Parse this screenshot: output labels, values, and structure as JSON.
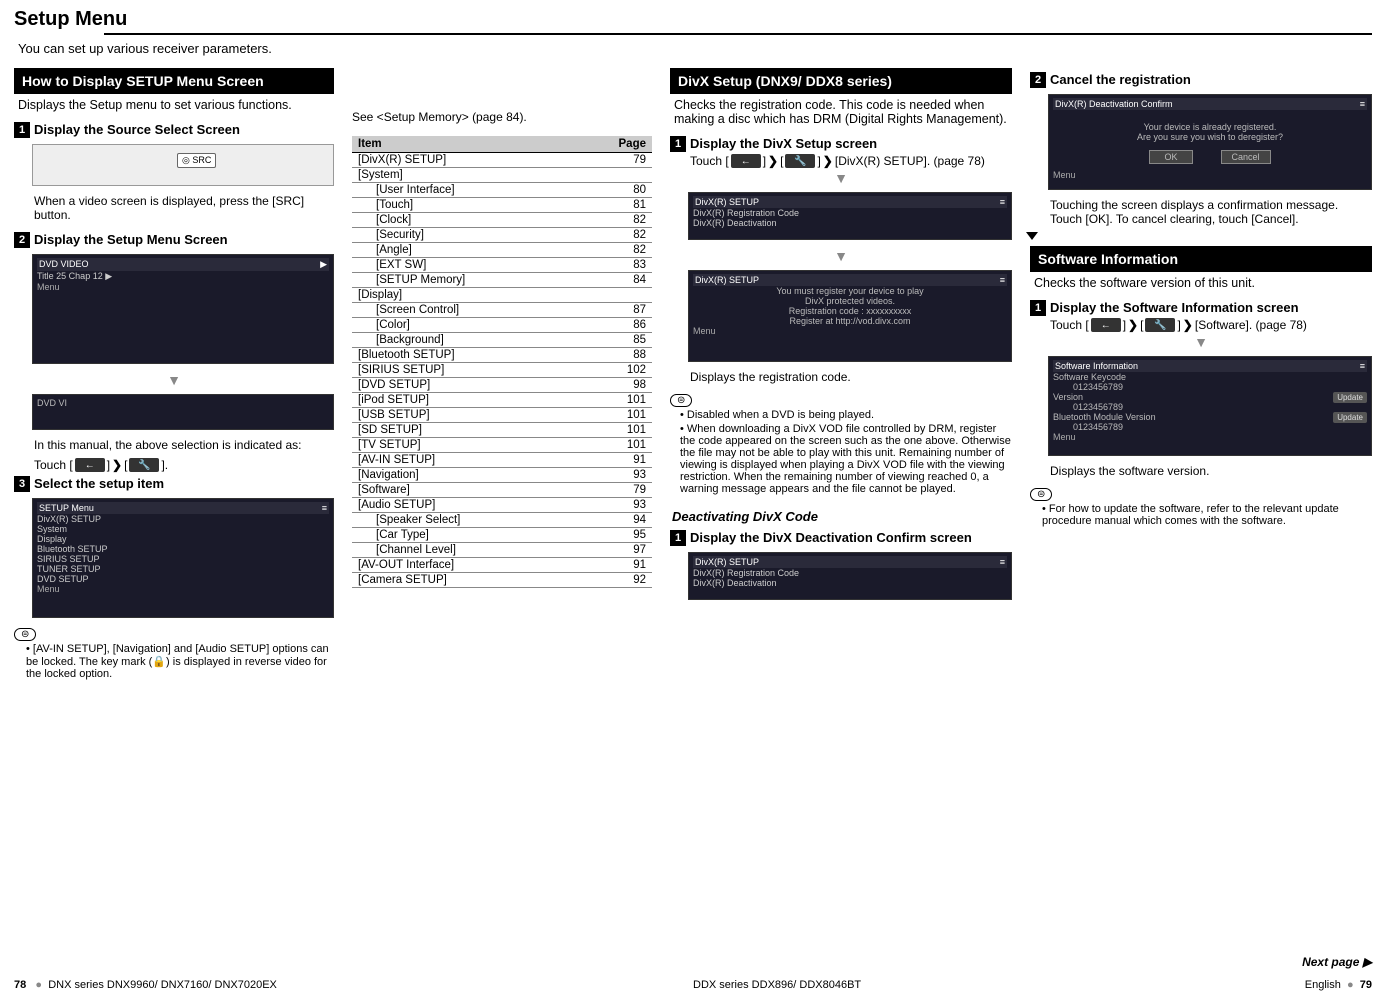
{
  "page_title": "Setup Menu",
  "intro": "You can set up various receiver parameters.",
  "col1": {
    "header": "How to Display SETUP Menu Screen",
    "sub": "Displays the Setup menu to set various functions.",
    "step1": "Display the Source Select Screen",
    "src_btn": "◎ SRC",
    "step1_body": "When a video screen is displayed, press the [SRC] button.",
    "step2": "Display the Setup Menu Screen",
    "dvd_title": "DVD VIDEO",
    "dvd_sub": "Title 25   Chap 12  ▶",
    "step2_body1": "In this manual, the above selection is indicated as:",
    "step2_body2a": "Touch [",
    "step2_body2b": "] ",
    "step2_body2c": " [",
    "step2_body2d": "].",
    "step3": "Select the setup item",
    "setup_menu_title": "SETUP Menu",
    "setup_menu_items": [
      "DivX(R) SETUP",
      "System",
      "Display",
      "Bluetooth SETUP",
      "SIRIUS SETUP",
      "TUNER SETUP",
      "DVD SETUP"
    ],
    "note1": "• [AV-IN SETUP], [Navigation] and [Audio SETUP] options can be locked. The key mark (🔒) is displayed in reverse video for the locked option."
  },
  "col2": {
    "see": "See <Setup Memory> (page 84).",
    "th_item": "Item",
    "th_page": "Page",
    "rows": [
      {
        "label": "[DivX(R) SETUP]",
        "page": "79",
        "indent": 0
      },
      {
        "label": "[System]",
        "page": "",
        "indent": 0
      },
      {
        "label": "[User Interface]",
        "page": "80",
        "indent": 1
      },
      {
        "label": "[Touch]",
        "page": "81",
        "indent": 1
      },
      {
        "label": "[Clock]",
        "page": "82",
        "indent": 1
      },
      {
        "label": "[Security]",
        "page": "82",
        "indent": 1
      },
      {
        "label": "[Angle]",
        "page": "82",
        "indent": 1
      },
      {
        "label": "[EXT SW]",
        "page": "83",
        "indent": 1
      },
      {
        "label": "[SETUP Memory]",
        "page": "84",
        "indent": 1
      },
      {
        "label": "[Display]",
        "page": "",
        "indent": 0
      },
      {
        "label": "[Screen Control]",
        "page": "87",
        "indent": 1
      },
      {
        "label": "[Color]",
        "page": "86",
        "indent": 1
      },
      {
        "label": "[Background]",
        "page": "85",
        "indent": 1
      },
      {
        "label": "[Bluetooth SETUP]",
        "page": "88",
        "indent": 0
      },
      {
        "label": "[SIRIUS SETUP]",
        "page": "102",
        "indent": 0
      },
      {
        "label": "[DVD SETUP]",
        "page": "98",
        "indent": 0
      },
      {
        "label": "[iPod SETUP]",
        "page": "101",
        "indent": 0
      },
      {
        "label": "[USB SETUP]",
        "page": "101",
        "indent": 0
      },
      {
        "label": "[SD SETUP]",
        "page": "101",
        "indent": 0
      },
      {
        "label": "[TV SETUP]",
        "page": "101",
        "indent": 0
      },
      {
        "label": "[AV-IN SETUP]",
        "page": "91",
        "indent": 0
      },
      {
        "label": "[Navigation]",
        "page": "93",
        "indent": 0
      },
      {
        "label": "[Software]",
        "page": "79",
        "indent": 0
      },
      {
        "label": "[Audio SETUP]",
        "page": "93",
        "indent": 0
      },
      {
        "label": "[Speaker Select]",
        "page": "94",
        "indent": 1
      },
      {
        "label": "[Car Type]",
        "page": "95",
        "indent": 1
      },
      {
        "label": "[Channel Level]",
        "page": "97",
        "indent": 1
      },
      {
        "label": "[AV-OUT Interface]",
        "page": "91",
        "indent": 0
      },
      {
        "label": "[Camera SETUP]",
        "page": "92",
        "indent": 0
      }
    ]
  },
  "col3": {
    "header": "DivX Setup (DNX9/ DDX8 series)",
    "sub": "Checks the registration code. This code is needed when making a disc which has DRM (Digital Rights Management).",
    "step1": "Display the DivX Setup screen",
    "touch_a": "Touch [",
    "touch_b": "] ",
    "touch_c": " [",
    "touch_d": "] ",
    "touch_e": " [DivX(R) SETUP]. (page 78)",
    "scr1_title": "DivX(R) SETUP",
    "scr1_r1": "DivX(R) Registration Code",
    "scr1_r2": "DivX(R) Deactivation",
    "scr2_title": "DivX(R) SETUP",
    "scr2_l1": "You must register your device to play",
    "scr2_l2": "DivX protected videos.",
    "scr2_l3": "Registration code : xxxxxxxxxx",
    "scr2_l4": "Register at http://vod.divx.com",
    "reg_line": "Displays the registration code.",
    "notes": [
      "Disabled when a DVD is being played.",
      "When downloading a DivX VOD file controlled by DRM, register the code appeared on the screen such as the one above. Otherwise the file may not be able to play with this unit. Remaining number of viewing is displayed when playing a DivX VOD file with the viewing restriction. When the remaining number of viewing reached 0, a warning message appears and the file cannot be played."
    ],
    "deact_head": "Deactivating DivX Code",
    "deact_step1": "Display the DivX Deactivation Confirm screen",
    "scr3_title": "DivX(R) SETUP",
    "scr3_r1": "DivX(R) Registration Code",
    "scr3_r2": "DivX(R) Deactivation"
  },
  "col4": {
    "step2": "Cancel the registration",
    "scr_title": "DivX(R) Deactivation Confirm",
    "scr_l1": "Your device is already registered.",
    "scr_l2": "Are you sure you wish to deregister?",
    "ok": "OK",
    "cancel": "Cancel",
    "body": "Touching the screen displays a confirmation message. Touch [OK]. To cancel clearing, touch [Cancel].",
    "si_header": "Software Information",
    "si_sub": "Checks the software version of this unit.",
    "si_step1": "Display the Software Information screen",
    "si_touch_a": "Touch [",
    "si_touch_e": " [Software]. (page 78)",
    "si_scr_title": "Software Information",
    "si_l1": "Software Keycode",
    "si_v1": "0123456789",
    "si_l2": "Version",
    "si_v2": "0123456789",
    "si_l3": "Bluetooth Module Version",
    "si_v3": "0123456789",
    "update": "Update",
    "si_disp": "Displays the software version.",
    "si_note": "• For how to update the software, refer to the relevant update procedure manual which comes with the software."
  },
  "next_page": "Next page ▶",
  "footer": {
    "left_pg": "78",
    "left_txt": "DNX series   DNX9960/ DNX7160/ DNX7020EX",
    "mid_txt": "DDX series   DDX896/ DDX8046BT",
    "right_txt": "English",
    "right_pg": "79"
  }
}
